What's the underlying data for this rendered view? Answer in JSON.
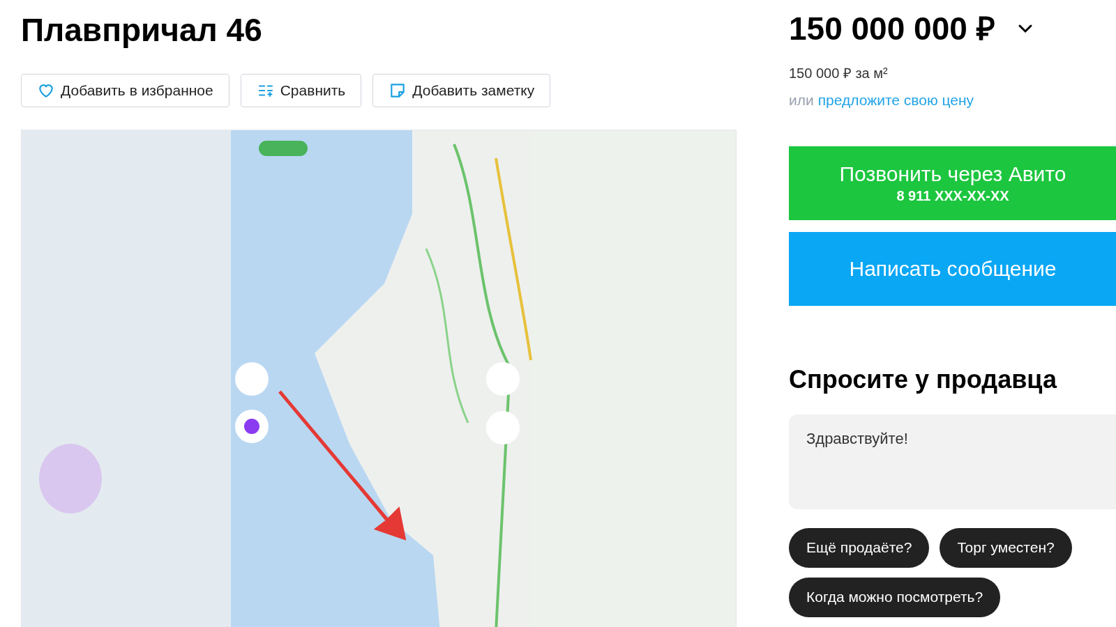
{
  "title": "Плавпричал 46",
  "actions": [
    {
      "kind": "favorite",
      "label": "Добавить в избранное"
    },
    {
      "kind": "compare",
      "label": "Сравнить"
    },
    {
      "kind": "note",
      "label": "Добавить заметку"
    }
  ],
  "price": {
    "amount": "150 000 000 ₽",
    "per_unit": "150 000 ₽ за м²",
    "offer_prefix": "или",
    "offer_link": "предложите свою цену"
  },
  "call_button": {
    "label": "Позвонить через Авито",
    "phone": "8 911 XXX-XX-XX"
  },
  "message_button": {
    "label": "Написать сообщение"
  },
  "ask_seller": {
    "heading": "Спросите у продавца",
    "message": "Здравствуйте!",
    "quick_replies": [
      "Ещё продаёте?",
      "Торг уместен?",
      "Когда можно посмотреть?"
    ]
  }
}
